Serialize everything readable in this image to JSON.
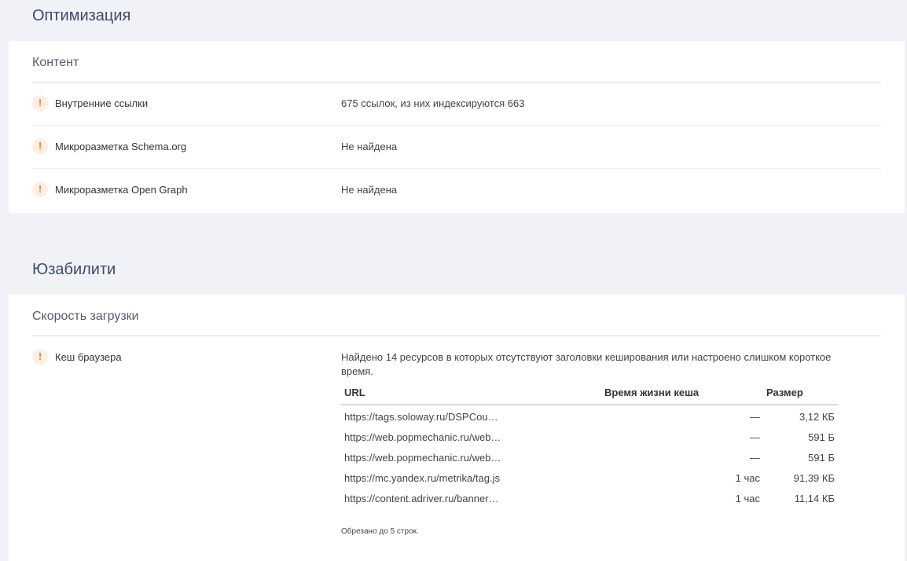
{
  "sections": [
    {
      "title": "Оптимизация",
      "group": "Контент",
      "rows": [
        {
          "icon": "warning-icon",
          "mark": "!",
          "label": "Внутренние ссылки",
          "value": "675 ссылок, из них индексируются 663"
        },
        {
          "icon": "warning-icon",
          "mark": "!",
          "label": "Микроразметка Schema.org",
          "value": "Не найдена"
        },
        {
          "icon": "warning-icon",
          "mark": "!",
          "label": "Микроразметка Open Graph",
          "value": "Не найдена"
        }
      ]
    },
    {
      "title": "Юзабилити",
      "group": "Скорость загрузки",
      "cache": {
        "icon": "warning-icon",
        "mark": "!",
        "label": "Кеш браузера",
        "description": "Найдено 14 ресурсов в которых отсутствуют заголовки кеширования или настроено слишком короткое время.",
        "columns": [
          "URL",
          "Время жизни кеша",
          "Размер"
        ],
        "rows": [
          [
            "https://tags.soloway.ru/DSPCou…",
            "—",
            "3,12 КБ"
          ],
          [
            "https://web.popmechanic.ru/web…",
            "—",
            "591 Б"
          ],
          [
            "https://web.popmechanic.ru/web…",
            "—",
            "591 Б"
          ],
          [
            "https://mc.yandex.ru/metrika/tag.js",
            "1 час",
            "91,39 КБ"
          ],
          [
            "https://content.adriver.ru/banner…",
            "1 час",
            "11,14 КБ"
          ]
        ],
        "note": "Обрезано до 5 строк."
      }
    }
  ],
  "colors": {
    "background": "#f1f2f6",
    "title": "#3d4a6b",
    "warning": "#e8842f",
    "warning_bg": "#fdefe4"
  }
}
